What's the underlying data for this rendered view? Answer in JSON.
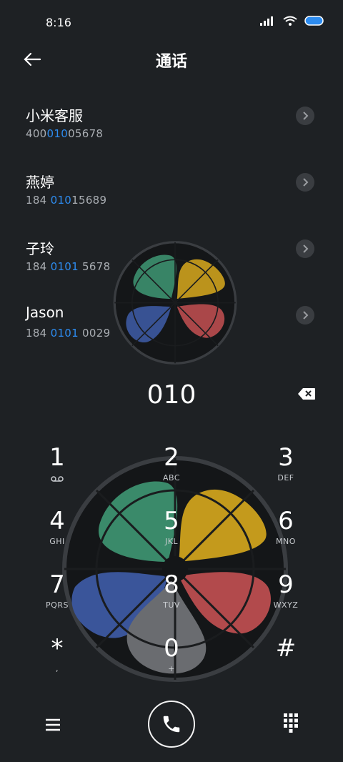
{
  "status": {
    "time": "8:16"
  },
  "header": {
    "title": "通话"
  },
  "contacts": [
    {
      "name": "小米客服",
      "num_pre": "400",
      "num_hl": "010",
      "num_post": "05678"
    },
    {
      "name": "燕婷",
      "num_pre": "184 ",
      "num_hl": "010",
      "num_post": "15689"
    },
    {
      "name": "子玲",
      "num_pre": "184 ",
      "num_hl": "0101",
      "num_post": " 5678"
    },
    {
      "name": "Jason",
      "num_pre": "184 ",
      "num_hl": "0101",
      "num_post": " 0029"
    }
  ],
  "dialer": {
    "input": "010",
    "keys": [
      {
        "digit": "1",
        "letters": ""
      },
      {
        "digit": "2",
        "letters": "ABC"
      },
      {
        "digit": "3",
        "letters": "DEF"
      },
      {
        "digit": "4",
        "letters": "GHI"
      },
      {
        "digit": "5",
        "letters": "JKL"
      },
      {
        "digit": "6",
        "letters": "MNO"
      },
      {
        "digit": "7",
        "letters": "PQRS"
      },
      {
        "digit": "8",
        "letters": "TUV"
      },
      {
        "digit": "9",
        "letters": "WXYZ"
      },
      {
        "digit": "*",
        "letters": ","
      },
      {
        "digit": "0",
        "letters": "+"
      },
      {
        "digit": "#",
        "letters": ""
      }
    ]
  },
  "colors": {
    "bg": "#1e2124",
    "highlight": "#2d8cf0",
    "petal_green": "#3a8a6a",
    "petal_yellow": "#c49a1c",
    "petal_red": "#b24a4c",
    "petal_blue": "#3a559a",
    "petal_gray": "#6a6c70"
  },
  "icons": [
    "back-arrow-icon",
    "chevron-right-icon",
    "backspace-icon",
    "voicemail-icon",
    "menu-icon",
    "phone-icon",
    "dialpad-grid-icon",
    "wifi-icon",
    "signal-icon",
    "battery-icon"
  ]
}
